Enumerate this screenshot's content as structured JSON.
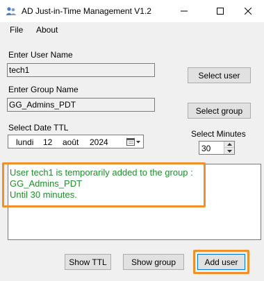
{
  "window": {
    "title": "AD Just-in-Time Management V1.2"
  },
  "menu": {
    "items": [
      {
        "label": "File"
      },
      {
        "label": "About"
      }
    ]
  },
  "form": {
    "user_label": "Enter User Name",
    "user_value": "tech1",
    "group_label": "Enter Group Name",
    "group_value": "GG_Admins_PDT",
    "date_label": "Select Date TTL",
    "date_day_name": "lundi",
    "date_day": "12",
    "date_month": "août",
    "date_year": "2024",
    "minutes_label": "Select Minutes",
    "minutes_value": "30"
  },
  "buttons": {
    "select_user": "Select user",
    "select_group": "Select group",
    "show_ttl": "Show TTL",
    "show_group": "Show group",
    "add_user": "Add user"
  },
  "output": {
    "lines": [
      "User tech1 is temporarily added to the group :",
      "GG_Admins_PDT",
      " Until 30 minutes."
    ]
  },
  "colors": {
    "output_text": "#1d8f2a",
    "highlight": "#f0902d"
  }
}
